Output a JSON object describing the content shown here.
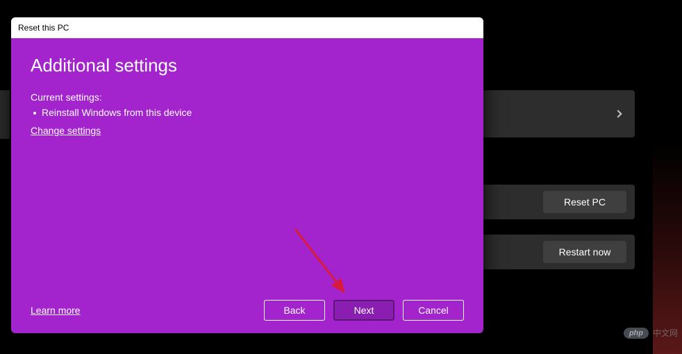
{
  "dialog": {
    "title": "Reset this PC",
    "heading": "Additional settings",
    "current_settings_label": "Current settings:",
    "settings_items": [
      "Reinstall Windows from this device"
    ],
    "change_settings": "Change settings",
    "learn_more": "Learn more",
    "buttons": {
      "back": "Back",
      "next": "Next",
      "cancel": "Cancel"
    }
  },
  "background_page": {
    "reset_pc_button": "Reset PC",
    "restart_now_button": "Restart now"
  },
  "watermark": {
    "badge": "php",
    "text": "中文网"
  }
}
